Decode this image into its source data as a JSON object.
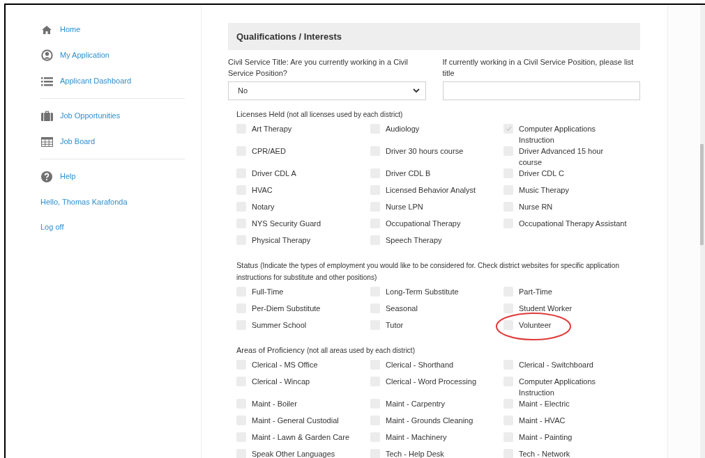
{
  "sidebar": {
    "groups": [
      {
        "items": [
          {
            "label": "Home"
          },
          {
            "label": "My Application"
          },
          {
            "label": "Applicant Dashboard"
          }
        ]
      },
      {
        "items": [
          {
            "label": "Job Opportunities"
          },
          {
            "label": "Job Board"
          }
        ]
      },
      {
        "items": [
          {
            "label": "Help"
          }
        ]
      }
    ],
    "greeting": "Hello, Thomas Karafonda",
    "logoff": "Log off"
  },
  "section": {
    "title": "Qualifications / Interests",
    "civil_service": {
      "label": "Civil Service Title: Are you currently working in a Civil Service Position?",
      "value": "No"
    },
    "position_title": {
      "label": "If currently working in a Civil Service Position, please list title"
    },
    "groups": [
      {
        "label": "Licenses Held",
        "note": "(not all licenses used by each district)",
        "items": [
          {
            "label": "Art Therapy",
            "checked": false
          },
          {
            "label": "Audiology",
            "checked": false
          },
          {
            "label": "Computer Applications Instruction",
            "checked": true
          },
          {
            "label": "CPR/AED",
            "checked": false
          },
          {
            "label": "Driver 30 hours course",
            "checked": false
          },
          {
            "label": "Driver Advanced 15 hour course",
            "checked": false
          },
          {
            "label": "Driver CDL A",
            "checked": false
          },
          {
            "label": "Driver CDL B",
            "checked": false
          },
          {
            "label": "Driver CDL C",
            "checked": false
          },
          {
            "label": "HVAC",
            "checked": false
          },
          {
            "label": "Licensed Behavior Analyst",
            "checked": false
          },
          {
            "label": "Music Therapy",
            "checked": false
          },
          {
            "label": "Notary",
            "checked": false
          },
          {
            "label": "Nurse LPN",
            "checked": false
          },
          {
            "label": "Nurse RN",
            "checked": false
          },
          {
            "label": "NYS Security Guard",
            "checked": false
          },
          {
            "label": "Occupational Therapy",
            "checked": false
          },
          {
            "label": "Occupational Therapy Assistant",
            "checked": false
          },
          {
            "label": "Physical Therapy",
            "checked": false
          },
          {
            "label": "Speech Therapy",
            "checked": false
          }
        ]
      },
      {
        "label": "Status",
        "note": "(Indicate the types of employment you would like to be considered for. Check district websites for specific application instructions for substitute and other positions)",
        "items": [
          {
            "label": "Full-Time",
            "checked": false
          },
          {
            "label": "Long-Term Substitute",
            "checked": false
          },
          {
            "label": "Part-Time",
            "checked": false
          },
          {
            "label": "Per-Diem Substitute",
            "checked": false
          },
          {
            "label": "Seasonal",
            "checked": false
          },
          {
            "label": "Student Worker",
            "checked": false
          },
          {
            "label": "Summer School",
            "checked": false
          },
          {
            "label": "Tutor",
            "checked": false
          },
          {
            "label": "Volunteer",
            "checked": false,
            "circled": true
          }
        ]
      },
      {
        "label": "Areas of Proficiency",
        "note": "(not all areas used by each district)",
        "items": [
          {
            "label": "Clerical - MS Office",
            "checked": false
          },
          {
            "label": "Clerical - Shorthand",
            "checked": false
          },
          {
            "label": "Clerical - Switchboard",
            "checked": false
          },
          {
            "label": "Clerical - Wincap",
            "checked": false
          },
          {
            "label": "Clerical - Word Processing",
            "checked": false
          },
          {
            "label": "Computer Applications Instruction",
            "checked": false
          },
          {
            "label": "Maint - Boiler",
            "checked": false
          },
          {
            "label": "Maint - Carpentry",
            "checked": false
          },
          {
            "label": "Maint - Electric",
            "checked": false
          },
          {
            "label": "Maint - General Custodial",
            "checked": false
          },
          {
            "label": "Maint - Grounds Cleaning",
            "checked": false
          },
          {
            "label": "Maint - HVAC",
            "checked": false
          },
          {
            "label": "Maint - Lawn & Garden Care",
            "checked": false
          },
          {
            "label": "Maint - Machinery",
            "checked": false
          },
          {
            "label": "Maint - Painting",
            "checked": false
          },
          {
            "label": "Speak Other Languages",
            "checked": false
          },
          {
            "label": "Tech - Help Desk",
            "checked": false
          },
          {
            "label": "Tech - Network",
            "checked": false
          }
        ]
      }
    ]
  }
}
